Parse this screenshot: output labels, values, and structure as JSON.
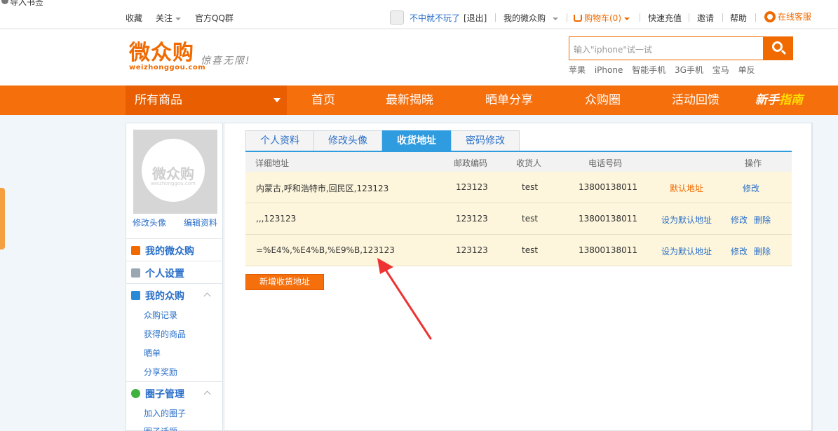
{
  "browser": {
    "bookmark": "导入书签"
  },
  "topbar": {
    "favorite": "收藏",
    "follow": "关注",
    "qq_group": "官方QQ群",
    "username": "不中就不玩了",
    "logout": "[退出]",
    "my_account": "我的微众购",
    "cart": "购物车(0)",
    "recharge": "快速充值",
    "invite": "邀请",
    "help": "帮助",
    "service": "在线客服"
  },
  "header": {
    "logo_main": "微众购",
    "logo_sub": "weizhonggou.com",
    "slogan": "惊喜无限!",
    "search_placeholder": "输入\"iphone\"试一试",
    "hotwords": [
      "苹果",
      "iPhone",
      "智能手机",
      "3G手机",
      "宝马",
      "单反"
    ]
  },
  "nav": {
    "all_products": "所有商品",
    "items": [
      "首页",
      "最新揭晓",
      "晒单分享",
      "众购圈",
      "活动回馈"
    ],
    "newbie_a": "新手",
    "newbie_b": "指南"
  },
  "sidebar": {
    "avatar_text": "微众购",
    "avatar_sub": "weizhonggou.com",
    "edit_avatar": "修改头像",
    "edit_profile": "编辑资料",
    "groups": [
      {
        "title": "我的微众购"
      },
      {
        "title": "个人设置"
      },
      {
        "title": "我的众购",
        "items": [
          "众购记录",
          "获得的商品",
          "晒单",
          "分享奖励"
        ]
      },
      {
        "title": "圈子管理",
        "items": [
          "加入的圈子",
          "圈子话题"
        ]
      }
    ]
  },
  "tabs": [
    "个人资料",
    "修改头像",
    "收货地址",
    "密码修改"
  ],
  "table": {
    "headers": [
      "详细地址",
      "邮政编码",
      "收货人",
      "电话号码",
      "操作"
    ],
    "rows": [
      {
        "address": "内蒙古,呼和浩特市,回民区,123123",
        "zip": "123123",
        "receiver": "test",
        "phone": "13800138011",
        "status": "默认地址",
        "edit": "修改",
        "delete": ""
      },
      {
        "address": ",,,123123",
        "zip": "123123",
        "receiver": "test",
        "phone": "13800138011",
        "status": "设为默认地址",
        "edit": "修改",
        "delete": "删除"
      },
      {
        "address": "=%E4%,%E4%B,%E9%B,123123",
        "zip": "123123",
        "receiver": "test",
        "phone": "13800138011",
        "status": "设为默认地址",
        "edit": "修改",
        "delete": "删除"
      }
    ]
  },
  "add_address": "新增收货地址",
  "colors": {
    "accent": "#f56f0d",
    "tab_active": "#2f9ce0",
    "link": "#2a6fc9",
    "row_bg": "#fdf6dc",
    "annotation": "#ee3333"
  }
}
